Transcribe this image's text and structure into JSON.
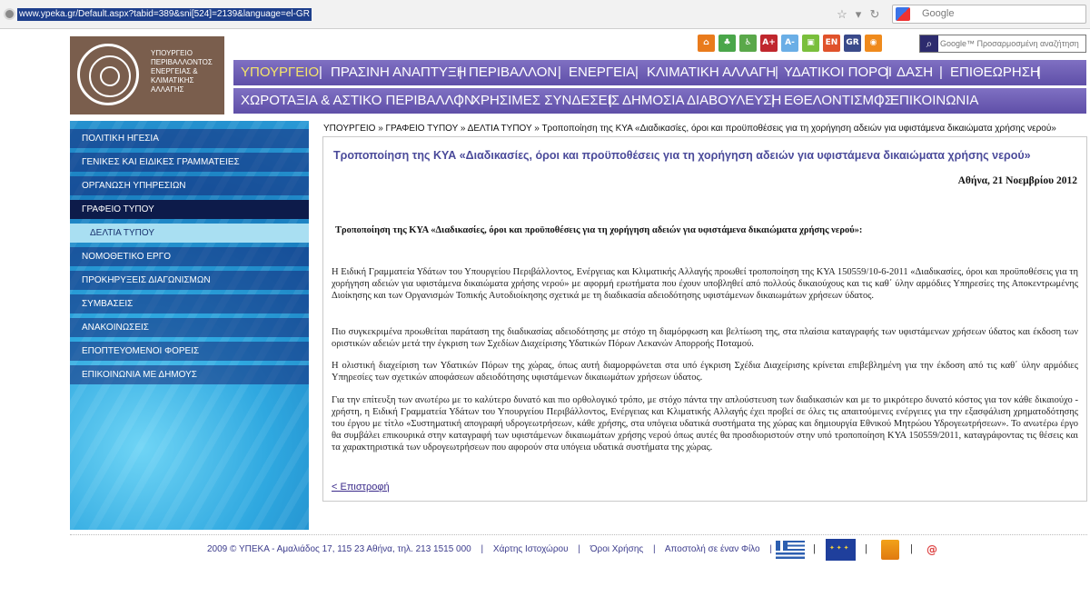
{
  "browser": {
    "url": "www.ypeka.gr/Default.aspx?tabid=389&sni[524]=2139&language=el-GR",
    "search_placeholder": "Google"
  },
  "logo": {
    "lines": [
      "ΥΠΟΥΡΓΕΙΟ",
      "ΠΕΡΙΒΑΛΛΟΝΤΟΣ",
      "ΕΝΕΡΓΕΙΑΣ &",
      "ΚΛΙΜΑΤΙΚΗΣ",
      "ΑΛΛΑΓΗΣ"
    ]
  },
  "toolbar_icons": [
    {
      "name": "home-icon",
      "label": "",
      "color": "#e97b1c"
    },
    {
      "name": "sitemap-icon",
      "label": "",
      "color": "#4aa64a"
    },
    {
      "name": "accessibility-icon",
      "label": "",
      "color": "#5aa84a"
    },
    {
      "name": "font-larger-icon",
      "label": "A+",
      "color": "#c0272d"
    },
    {
      "name": "font-smaller-icon",
      "label": "A-",
      "color": "#6aaee6"
    },
    {
      "name": "print-icon",
      "label": "",
      "color": "#7abf3c"
    },
    {
      "name": "english-icon",
      "label": "EN",
      "color": "#e0522b"
    },
    {
      "name": "greek-icon",
      "label": "GR",
      "color": "#3a4a8a"
    },
    {
      "name": "rss-icon",
      "label": "",
      "color": "#ef8a1c"
    }
  ],
  "search": {
    "placeholder": "Google™ Προσαρμοσμένη αναζήτηση"
  },
  "nav_primary": [
    "ΥΠΟΥΡΓΕΙΟ",
    "ΠΡΑΣΙΝΗ ΑΝΑΠΤΥΞΗ",
    "ΠΕΡΙΒΑΛΛΟΝ",
    "ΕΝΕΡΓΕΙΑ",
    "ΚΛΙΜΑΤΙΚΗ ΑΛΛΑΓΗ",
    "ΥΔΑΤΙΚΟΙ ΠΟΡΟΙ",
    "ΔΑΣΗ",
    "ΕΠΙΘΕΩΡΗΣΗ"
  ],
  "nav_secondary": [
    "ΧΩΡΟΤΑΞΙΑ & ΑΣΤΙΚΟ ΠΕΡΙΒΑΛΛΟΝ",
    "ΧΡΗΣΙΜΕΣ ΣΥΝΔΕΣΕΙΣ",
    "ΔΗΜΟΣΙΑ ΔΙΑΒΟΥΛΕΥΣΗ",
    "ΕΘΕΛΟΝΤΙΣΜΟΣ",
    "ΕΠΙΚΟΙΝΩΝΙΑ"
  ],
  "sidebar": {
    "items": [
      "ΠΟΛΙΤΙΚΗ ΗΓΕΣΙΑ",
      "ΓΕΝΙΚΕΣ ΚΑΙ ΕΙΔΙΚΕΣ ΓΡΑΜΜΑΤΕΙΕΣ",
      "ΟΡΓΑΝΩΣΗ ΥΠΗΡΕΣΙΩΝ",
      "ΓΡΑΦΕΙΟ ΤΥΠΟΥ",
      "ΔΕΛΤΙΑ ΤΥΠΟΥ",
      "ΝΟΜΟΘΕΤΙΚΟ ΕΡΓΟ",
      "ΠΡΟΚΗΡΥΞΕΙΣ ΔΙΑΓΩΝΙΣΜΩΝ",
      "ΣΥΜΒΑΣΕΙΣ",
      "ΑΝΑΚΟΙΝΩΣΕΙΣ",
      "ΕΠΟΠΤΕΥΟΜΕΝΟΙ ΦΟΡΕΙΣ",
      "ΕΠΙΚΟΙΝΩΝΙΑ ΜΕ ΔΗΜΟΥΣ"
    ]
  },
  "breadcrumb": "ΥΠΟΥΡΓΕΙΟ » ΓΡΑΦΕΙΟ ΤΥΠΟΥ » ΔΕΛΤΙΑ ΤΥΠΟΥ » Τροποποίηση της ΚΥΑ «Διαδικασίες, όροι και προϋποθέσεις για τη χορήγηση αδειών για υφιστάμενα δικαιώματα χρήσης νερού»",
  "article": {
    "title": "Τροποποίηση της ΚΥΑ «Διαδικασίες, όροι και προϋποθέσεις για τη χορήγηση αδειών για υφιστάμενα δικαιώματα χρήσης νερού»",
    "date": "Αθήνα, 21 Νοεμβρίου 2012",
    "subhead": "Τροποποίηση της ΚΥΑ «Διαδικασίες, όροι και προϋποθέσεις για τη χορήγηση αδειών για υφιστάμενα δικαιώματα χρήσης νερού»:",
    "paragraphs": [
      "Η Ειδική Γραμματεία Υδάτων του Υπουργείου Περιβάλλοντος, Ενέργειας και Κλιματικής Αλλαγής προωθεί τροποποίηση της ΚΥΑ 150559/10-6-2011 «Διαδικασίες, όροι και προϋποθέσεις για τη χορήγηση αδειών για υφιστάμενα δικαιώματα χρήσης νερού» με αφορμή ερωτήματα που έχουν υποβληθεί από πολλούς δικαιούχους και τις καθ΄ ύλην αρμόδιες Υπηρεσίες της Αποκεντρωμένης Διοίκησης και των Οργανισμών Τοπικής Αυτοδιοίκησης σχετικά με τη διαδικασία αδειοδότησης υφιστάμενων δικαιωμάτων χρήσεων ύδατος.",
      "Πιο συγκεκριμένα προωθείται παράταση της διαδικασίας αδειοδότησης με στόχο τη διαμόρφωση και βελτίωση της, στα πλαίσια καταγραφής των υφιστάμενων χρήσεων ύδατος και έκδοση των οριστικών αδειών μετά την έγκριση των Σχεδίων Διαχείρισης Υδατικών Πόρων Λεκανών Απορροής Ποταμού.",
      "Η ολιστική διαχείριση των Υδατικών Πόρων της χώρας, όπως αυτή διαμορφώνεται στα υπό έγκριση Σχέδια Διαχείρισης κρίνεται επιβεβλημένη για την έκδοση από τις καθ΄ ύλην αρμόδιες Υπηρεσίες των σχετικών αποφάσεων αδειοδότησης υφιστάμενων δικαιωμάτων χρήσεων ύδατος.",
      "Για την επίτευξη των ανωτέρω με το καλύτερο δυνατό και πιο ορθολογικό τρόπο, με στόχο πάντα την απλούστευση των διαδικασιών και με το μικρότερο δυνατό κόστος για τον κάθε δικαιούχο - χρήστη, η Ειδική Γραμματεία Υδάτων του Υπουργείου Περιβάλλοντος, Ενέργειας και Κλιματικής Αλλαγής έχει προβεί σε όλες τις απαιτούμενες ενέργειες για την εξασφάλιση χρηματοδότησης του έργου με τίτλο «Συστηματική απογραφή υδρογεωτρήσεων, κάθε χρήσης, στα υπόγεια υδατικά συστήματα της χώρας και δημιουργία Εθνικού Μητρώου Υδρογεωτρήσεων». Το ανωτέρω έργο θα συμβάλει επικουρικά στην καταγραφή των υφιστάμενων δικαιωμάτων χρήσης νερού όπως αυτές θα προσδιοριστούν στην υπό τροποποίηση ΚΥΑ 150559/2011, καταγράφοντας τις θέσεις και τα χαρακτηριστικά των υδρογεωτρήσεων που αφορούν στα υπόγεια υδατικά συστήματα της χώρας."
    ],
    "back_link": "< Επιστροφή"
  },
  "footer": {
    "copyright": "2009 © ΥΠΕΚΑ - Αμαλιάδος 17, 115 23 Αθήνα, τηλ. 213 1515 000",
    "links": [
      "Χάρτης Ιστοχώρου",
      "Όροι Χρήσης",
      "Αποστολή σε έναν Φίλο"
    ]
  }
}
